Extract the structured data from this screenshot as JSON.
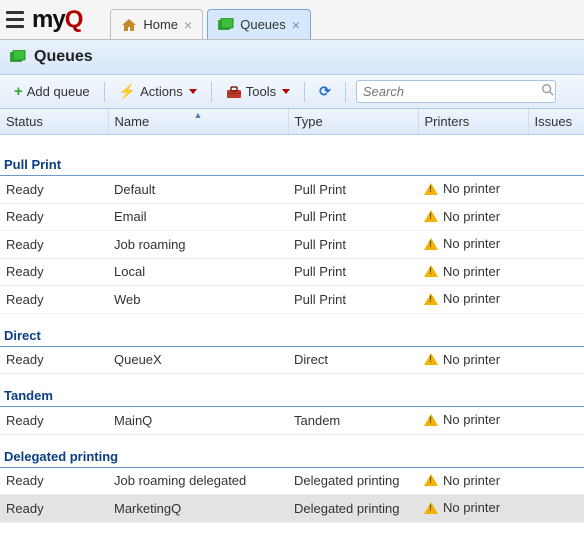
{
  "brand": {
    "part1": "my",
    "part2": "Q"
  },
  "tabs": [
    {
      "label": "Home",
      "active": false
    },
    {
      "label": "Queues",
      "active": true
    }
  ],
  "page": {
    "title": "Queues"
  },
  "toolbar": {
    "add_label": "Add queue",
    "actions_label": "Actions",
    "tools_label": "Tools",
    "search_placeholder": "Search"
  },
  "columns": {
    "status": "Status",
    "name": "Name",
    "type": "Type",
    "printers": "Printers",
    "issues": "Issues"
  },
  "no_printer_label": "No printer",
  "groups": [
    {
      "title": "Pull Print",
      "rows": [
        {
          "status": "Ready",
          "name": "Default",
          "type": "Pull Print",
          "warn": true
        },
        {
          "status": "Ready",
          "name": "Email",
          "type": "Pull Print",
          "warn": true
        },
        {
          "status": "Ready",
          "name": "Job roaming",
          "type": "Pull Print",
          "warn": true
        },
        {
          "status": "Ready",
          "name": "Local",
          "type": "Pull Print",
          "warn": true
        },
        {
          "status": "Ready",
          "name": "Web",
          "type": "Pull Print",
          "warn": true
        }
      ]
    },
    {
      "title": "Direct",
      "rows": [
        {
          "status": "Ready",
          "name": "QueueX",
          "type": "Direct",
          "warn": true
        }
      ]
    },
    {
      "title": "Tandem",
      "rows": [
        {
          "status": "Ready",
          "name": "MainQ",
          "type": "Tandem",
          "warn": true
        }
      ]
    },
    {
      "title": "Delegated printing",
      "rows": [
        {
          "status": "Ready",
          "name": "Job roaming delegated",
          "type": "Delegated printing",
          "warn": true
        },
        {
          "status": "Ready",
          "name": "MarketingQ",
          "type": "Delegated printing",
          "warn": true,
          "selected": true
        }
      ]
    }
  ]
}
